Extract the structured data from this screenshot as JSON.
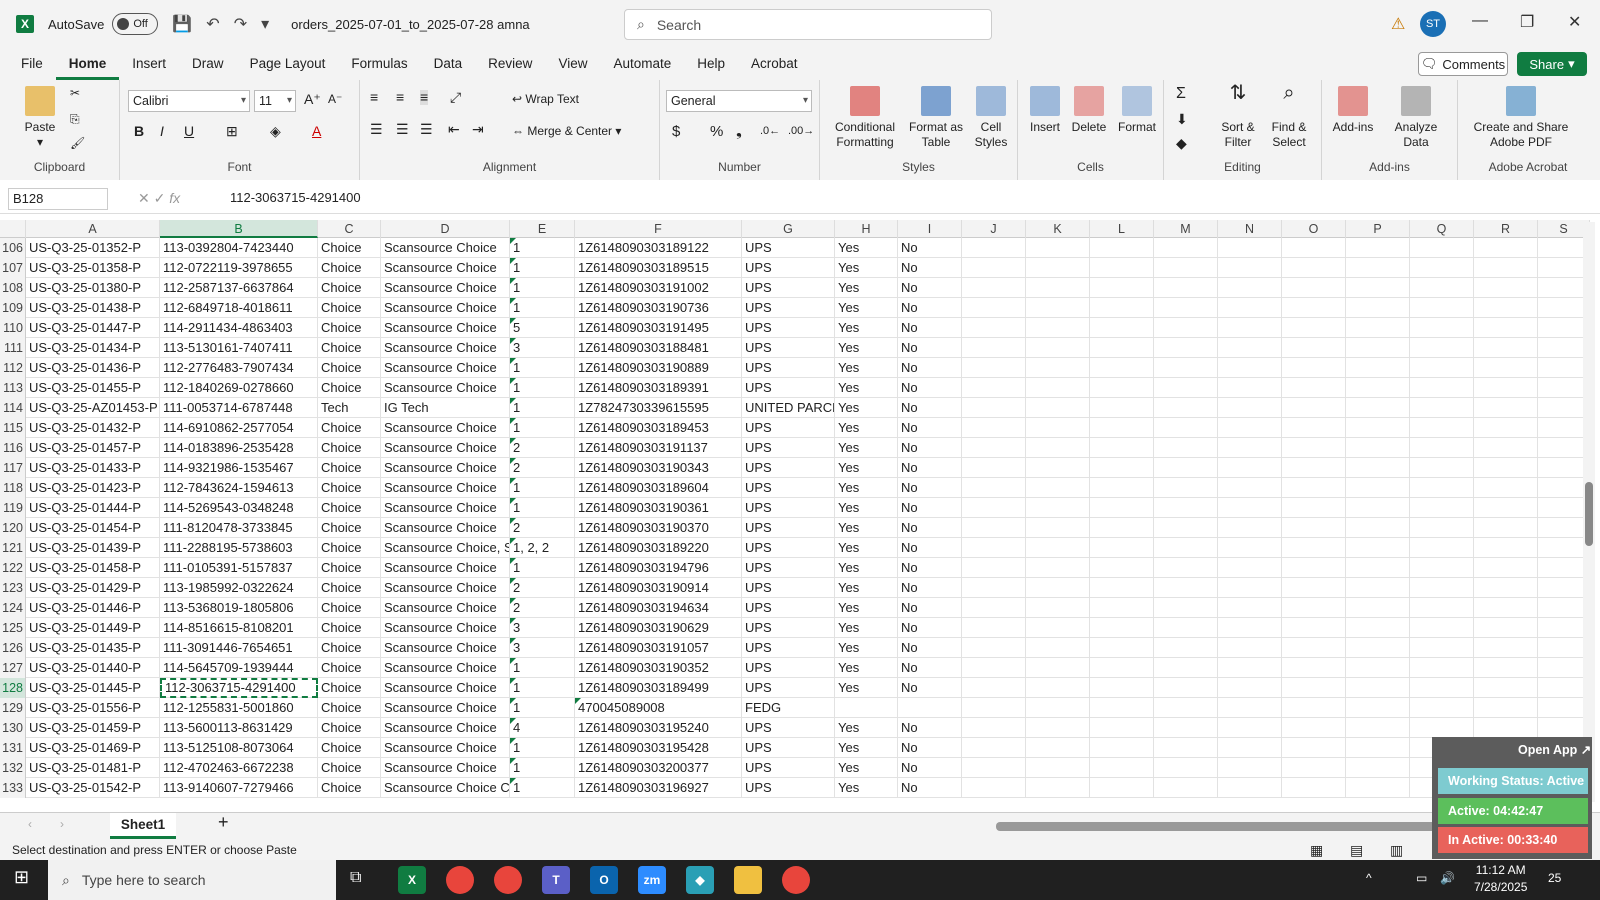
{
  "titlebar": {
    "autosave": "AutoSave",
    "toggle": "Off",
    "docname": "orders_2025-07-01_to_2025-07-28 amna",
    "search_placeholder": "Search",
    "avatar": "ST"
  },
  "menu": [
    "File",
    "Home",
    "Insert",
    "Draw",
    "Page Layout",
    "Formulas",
    "Data",
    "Review",
    "View",
    "Automate",
    "Help",
    "Acrobat"
  ],
  "comments": "Comments",
  "share": "Share",
  "ribbon": {
    "clipboard": "Clipboard",
    "paste": "Paste",
    "font": "Font",
    "font_name": "Calibri",
    "font_size": "11",
    "alignment": "Alignment",
    "wrap": "Wrap Text",
    "merge": "Merge & Center",
    "number": "Number",
    "number_format": "General",
    "styles": "Styles",
    "cond_fmt": "Conditional Formatting",
    "fmt_table": "Format as Table",
    "cell_styles": "Cell Styles",
    "cells": "Cells",
    "insert": "Insert",
    "delete": "Delete",
    "format": "Format",
    "editing": "Editing",
    "sort": "Sort & Filter",
    "find": "Find & Select",
    "addins_group": "Add-ins",
    "addins": "Add-ins",
    "analyze": "Analyze Data",
    "acrobat_group": "Adobe Acrobat",
    "create_pdf": "Create and Share Adobe PDF"
  },
  "formulabar": {
    "namebox": "B128",
    "formula": "112-3063715-4291400"
  },
  "columns": [
    "A",
    "B",
    "C",
    "D",
    "E",
    "F",
    "G",
    "H",
    "I",
    "J",
    "K",
    "L",
    "M",
    "N",
    "O",
    "P",
    "Q",
    "R",
    "S"
  ],
  "rows": [
    [
      "106",
      "US-Q3-25-01352-P",
      "113-0392804-7423440",
      "Choice",
      "Scansource Choice",
      "1",
      "1Z6148090303189122",
      "UPS",
      "Yes",
      "No"
    ],
    [
      "107",
      "US-Q3-25-01358-P",
      "112-0722119-3978655",
      "Choice",
      "Scansource Choice",
      "1",
      "1Z6148090303189515",
      "UPS",
      "Yes",
      "No"
    ],
    [
      "108",
      "US-Q3-25-01380-P",
      "112-2587137-6637864",
      "Choice",
      "Scansource Choice",
      "1",
      "1Z6148090303191002",
      "UPS",
      "Yes",
      "No"
    ],
    [
      "109",
      "US-Q3-25-01438-P",
      "112-6849718-4018611",
      "Choice",
      "Scansource Choice",
      "1",
      "1Z6148090303190736",
      "UPS",
      "Yes",
      "No"
    ],
    [
      "110",
      "US-Q3-25-01447-P",
      "114-2911434-4863403",
      "Choice",
      "Scansource Choice",
      "5",
      "1Z6148090303191495",
      "UPS",
      "Yes",
      "No"
    ],
    [
      "111",
      "US-Q3-25-01434-P",
      "113-5130161-7407411",
      "Choice",
      "Scansource Choice",
      "3",
      "1Z6148090303188481",
      "UPS",
      "Yes",
      "No"
    ],
    [
      "112",
      "US-Q3-25-01436-P",
      "112-2776483-7907434",
      "Choice",
      "Scansource Choice",
      "1",
      "1Z6148090303190889",
      "UPS",
      "Yes",
      "No"
    ],
    [
      "113",
      "US-Q3-25-01455-P",
      "112-1840269-0278660",
      "Choice",
      "Scansource Choice",
      "1",
      "1Z6148090303189391",
      "UPS",
      "Yes",
      "No"
    ],
    [
      "114",
      "US-Q3-25-AZ01453-P",
      "111-0053714-6787448",
      "Tech",
      "IG Tech",
      "1",
      "1Z7824730339615595",
      "UNITED PARCE",
      "Yes",
      "No"
    ],
    [
      "115",
      "US-Q3-25-01432-P",
      "114-6910862-2577054",
      "Choice",
      "Scansource Choice",
      "1",
      "1Z6148090303189453",
      "UPS",
      "Yes",
      "No"
    ],
    [
      "116",
      "US-Q3-25-01457-P",
      "114-0183896-2535428",
      "Choice",
      "Scansource Choice",
      "2",
      "1Z6148090303191137",
      "UPS",
      "Yes",
      "No"
    ],
    [
      "117",
      "US-Q3-25-01433-P",
      "114-9321986-1535467",
      "Choice",
      "Scansource Choice",
      "2",
      "1Z6148090303190343",
      "UPS",
      "Yes",
      "No"
    ],
    [
      "118",
      "US-Q3-25-01423-P",
      "112-7843624-1594613",
      "Choice",
      "Scansource Choice",
      "1",
      "1Z6148090303189604",
      "UPS",
      "Yes",
      "No"
    ],
    [
      "119",
      "US-Q3-25-01444-P",
      "114-5269543-0348248",
      "Choice",
      "Scansource Choice",
      "1",
      "1Z6148090303190361",
      "UPS",
      "Yes",
      "No"
    ],
    [
      "120",
      "US-Q3-25-01454-P",
      "111-8120478-3733845",
      "Choice",
      "Scansource Choice",
      "2",
      "1Z6148090303190370",
      "UPS",
      "Yes",
      "No"
    ],
    [
      "121",
      "US-Q3-25-01439-P",
      "111-2288195-5738603",
      "Choice",
      "Scansource Choice, S",
      "1, 2, 2",
      "1Z6148090303189220",
      "UPS",
      "Yes",
      "No"
    ],
    [
      "122",
      "US-Q3-25-01458-P",
      "111-0105391-5157837",
      "Choice",
      "Scansource Choice",
      "1",
      "1Z6148090303194796",
      "UPS",
      "Yes",
      "No"
    ],
    [
      "123",
      "US-Q3-25-01429-P",
      "113-1985992-0322624",
      "Choice",
      "Scansource Choice",
      "2",
      "1Z6148090303190914",
      "UPS",
      "Yes",
      "No"
    ],
    [
      "124",
      "US-Q3-25-01446-P",
      "113-5368019-1805806",
      "Choice",
      "Scansource Choice",
      "2",
      "1Z6148090303194634",
      "UPS",
      "Yes",
      "No"
    ],
    [
      "125",
      "US-Q3-25-01449-P",
      "114-8516615-8108201",
      "Choice",
      "Scansource Choice",
      "3",
      "1Z6148090303190629",
      "UPS",
      "Yes",
      "No"
    ],
    [
      "126",
      "US-Q3-25-01435-P",
      "111-3091446-7654651",
      "Choice",
      "Scansource Choice",
      "3",
      "1Z6148090303191057",
      "UPS",
      "Yes",
      "No"
    ],
    [
      "127",
      "US-Q3-25-01440-P",
      "114-5645709-1939444",
      "Choice",
      "Scansource Choice",
      "1",
      "1Z6148090303190352",
      "UPS",
      "Yes",
      "No"
    ],
    [
      "128",
      "US-Q3-25-01445-P",
      "112-3063715-4291400",
      "Choice",
      "Scansource Choice",
      "1",
      "1Z6148090303189499",
      "UPS",
      "Yes",
      "No"
    ],
    [
      "129",
      "US-Q3-25-01556-P",
      "112-1255831-5001860",
      "Choice",
      "Scansource Choice",
      "1",
      "470045089008",
      "FEDG",
      "",
      ""
    ],
    [
      "130",
      "US-Q3-25-01459-P",
      "113-5600113-8631429",
      "Choice",
      "Scansource Choice",
      "4",
      "1Z6148090303195240",
      "UPS",
      "Yes",
      "No"
    ],
    [
      "131",
      "US-Q3-25-01469-P",
      "113-5125108-8073064",
      "Choice",
      "Scansource Choice",
      "1",
      "1Z6148090303195428",
      "UPS",
      "Yes",
      "No"
    ],
    [
      "132",
      "US-Q3-25-01481-P",
      "112-4702463-6672238",
      "Choice",
      "Scansource Choice",
      "1",
      "1Z6148090303200377",
      "UPS",
      "Yes",
      "No"
    ],
    [
      "133",
      "US-Q3-25-01542-P",
      "113-9140607-7279466",
      "Choice",
      "Scansource Choice C",
      "1",
      "1Z6148090303196927",
      "UPS",
      "Yes",
      "No"
    ]
  ],
  "sheet": "Sheet1",
  "status": "Select destination and press ENTER or choose Paste",
  "widget": {
    "open_app": "Open App ↗",
    "working": "Working Status: Active",
    "active": "Active: 04:42:47",
    "inactive": "In Active: 00:33:40",
    "colors": {
      "working": "#7ecbd0",
      "active": "#5cbf5c",
      "inactive": "#e8625b"
    }
  },
  "taskbar": {
    "search": "Type here to search",
    "time": "11:12 AM",
    "date": "7/28/2025",
    "notif": "25"
  }
}
